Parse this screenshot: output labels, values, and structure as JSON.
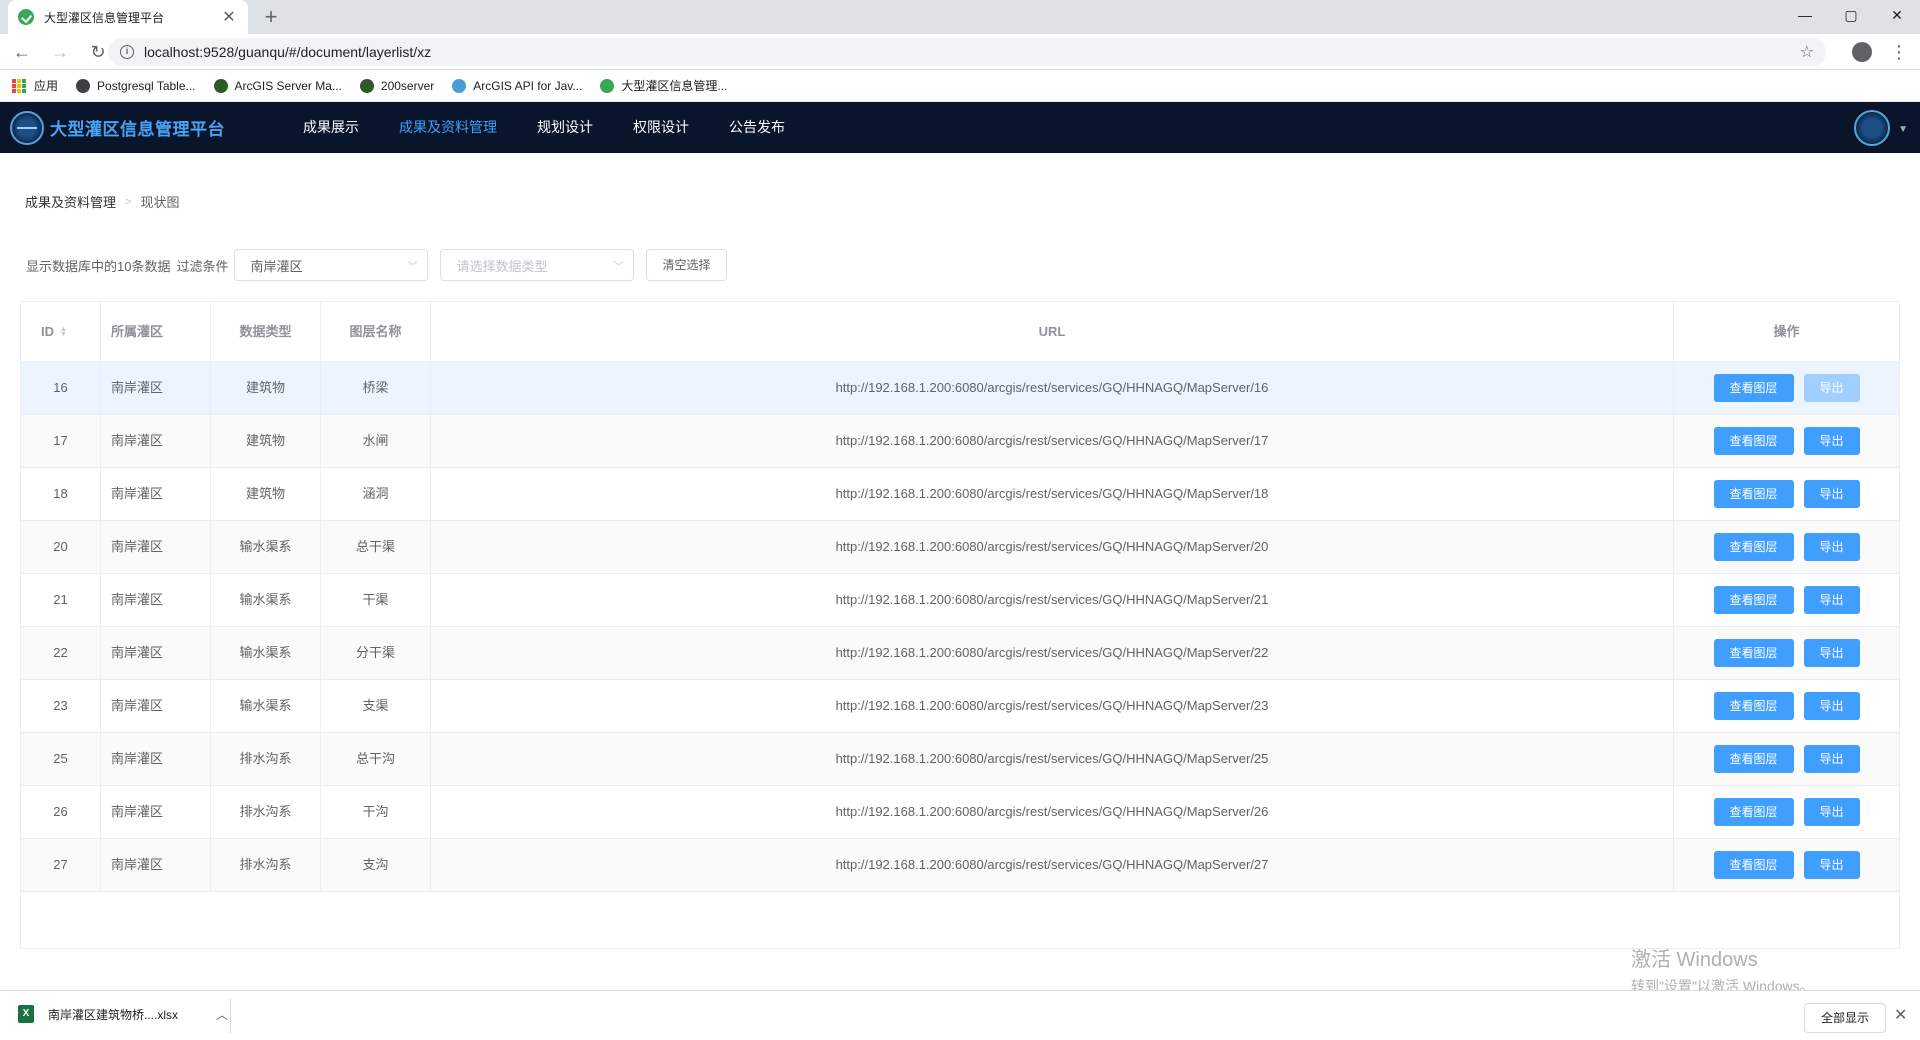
{
  "browser": {
    "tab_title": "大型灌区信息管理平台",
    "tab_close": "✕",
    "new_tab": "+",
    "window_controls": {
      "minimize": "—",
      "maximize": "▢",
      "close": "✕"
    },
    "nav": {
      "back": "←",
      "forward": "→",
      "reload": "↻"
    },
    "url": "localhost:9528/guanqu/#/document/layerlist/xz",
    "bookmarks": [
      {
        "label": "应用",
        "icon": "apps-grid-icon"
      },
      {
        "label": "Postgresql Table...",
        "icon": "globe-icon",
        "color": "#3c4043"
      },
      {
        "label": "ArcGIS Server Ma...",
        "icon": "arcgis-globe-icon",
        "color": "#2d5a27"
      },
      {
        "label": "200server",
        "icon": "arcgis-globe-icon",
        "color": "#2d5a27"
      },
      {
        "label": "ArcGIS API for Jav...",
        "icon": "arcgis-api-icon",
        "color": "#4a9bd6"
      },
      {
        "label": "大型灌区信息管理...",
        "icon": "vue-icon",
        "color": "#3aa757"
      }
    ]
  },
  "app": {
    "title": "大型灌区信息管理平台",
    "accent": "#409eff",
    "header_bg": "#08152a",
    "nav": [
      {
        "label": "成果展示",
        "active": false
      },
      {
        "label": "成果及资料管理",
        "active": true
      },
      {
        "label": "规划设计",
        "active": false
      },
      {
        "label": "权限设计",
        "active": false
      },
      {
        "label": "公告发布",
        "active": false
      }
    ]
  },
  "breadcrumb": {
    "parent": "成果及资料管理",
    "current": "现状图"
  },
  "filter": {
    "count_text": "显示数据库中的10条数据",
    "label": "过滤条件",
    "area_value": "南岸灌区",
    "type_placeholder": "请选择数据类型",
    "clear_label": "清空选择"
  },
  "table": {
    "headers": {
      "id": "ID",
      "area": "所属灌区",
      "type": "数据类型",
      "name": "图层名称",
      "url": "URL",
      "op": "操作"
    },
    "view_label": "查看图层",
    "export_label": "导出",
    "rows": [
      {
        "id": "16",
        "area": "南岸灌区",
        "type": "建筑物",
        "name": "桥梁",
        "url": "http://192.168.1.200:6080/arcgis/rest/services/GQ/HHNAGQ/MapServer/16"
      },
      {
        "id": "17",
        "area": "南岸灌区",
        "type": "建筑物",
        "name": "水闸",
        "url": "http://192.168.1.200:6080/arcgis/rest/services/GQ/HHNAGQ/MapServer/17"
      },
      {
        "id": "18",
        "area": "南岸灌区",
        "type": "建筑物",
        "name": "涵洞",
        "url": "http://192.168.1.200:6080/arcgis/rest/services/GQ/HHNAGQ/MapServer/18"
      },
      {
        "id": "20",
        "area": "南岸灌区",
        "type": "输水渠系",
        "name": "总干渠",
        "url": "http://192.168.1.200:6080/arcgis/rest/services/GQ/HHNAGQ/MapServer/20"
      },
      {
        "id": "21",
        "area": "南岸灌区",
        "type": "输水渠系",
        "name": "干渠",
        "url": "http://192.168.1.200:6080/arcgis/rest/services/GQ/HHNAGQ/MapServer/21"
      },
      {
        "id": "22",
        "area": "南岸灌区",
        "type": "输水渠系",
        "name": "分干渠",
        "url": "http://192.168.1.200:6080/arcgis/rest/services/GQ/HHNAGQ/MapServer/22"
      },
      {
        "id": "23",
        "area": "南岸灌区",
        "type": "输水渠系",
        "name": "支渠",
        "url": "http://192.168.1.200:6080/arcgis/rest/services/GQ/HHNAGQ/MapServer/23"
      },
      {
        "id": "25",
        "area": "南岸灌区",
        "type": "排水沟系",
        "name": "总干沟",
        "url": "http://192.168.1.200:6080/arcgis/rest/services/GQ/HHNAGQ/MapServer/25"
      },
      {
        "id": "26",
        "area": "南岸灌区",
        "type": "排水沟系",
        "name": "干沟",
        "url": "http://192.168.1.200:6080/arcgis/rest/services/GQ/HHNAGQ/MapServer/26"
      },
      {
        "id": "27",
        "area": "南岸灌区",
        "type": "排水沟系",
        "name": "支沟",
        "url": "http://192.168.1.200:6080/arcgis/rest/services/GQ/HHNAGQ/MapServer/27"
      }
    ]
  },
  "watermark": {
    "line1": "激活 Windows",
    "line2": "转到\"设置\"以激活 Windows。"
  },
  "download": {
    "filename": "南岸灌区建筑物桥....xlsx",
    "show_all": "全部显示",
    "close": "✕"
  }
}
